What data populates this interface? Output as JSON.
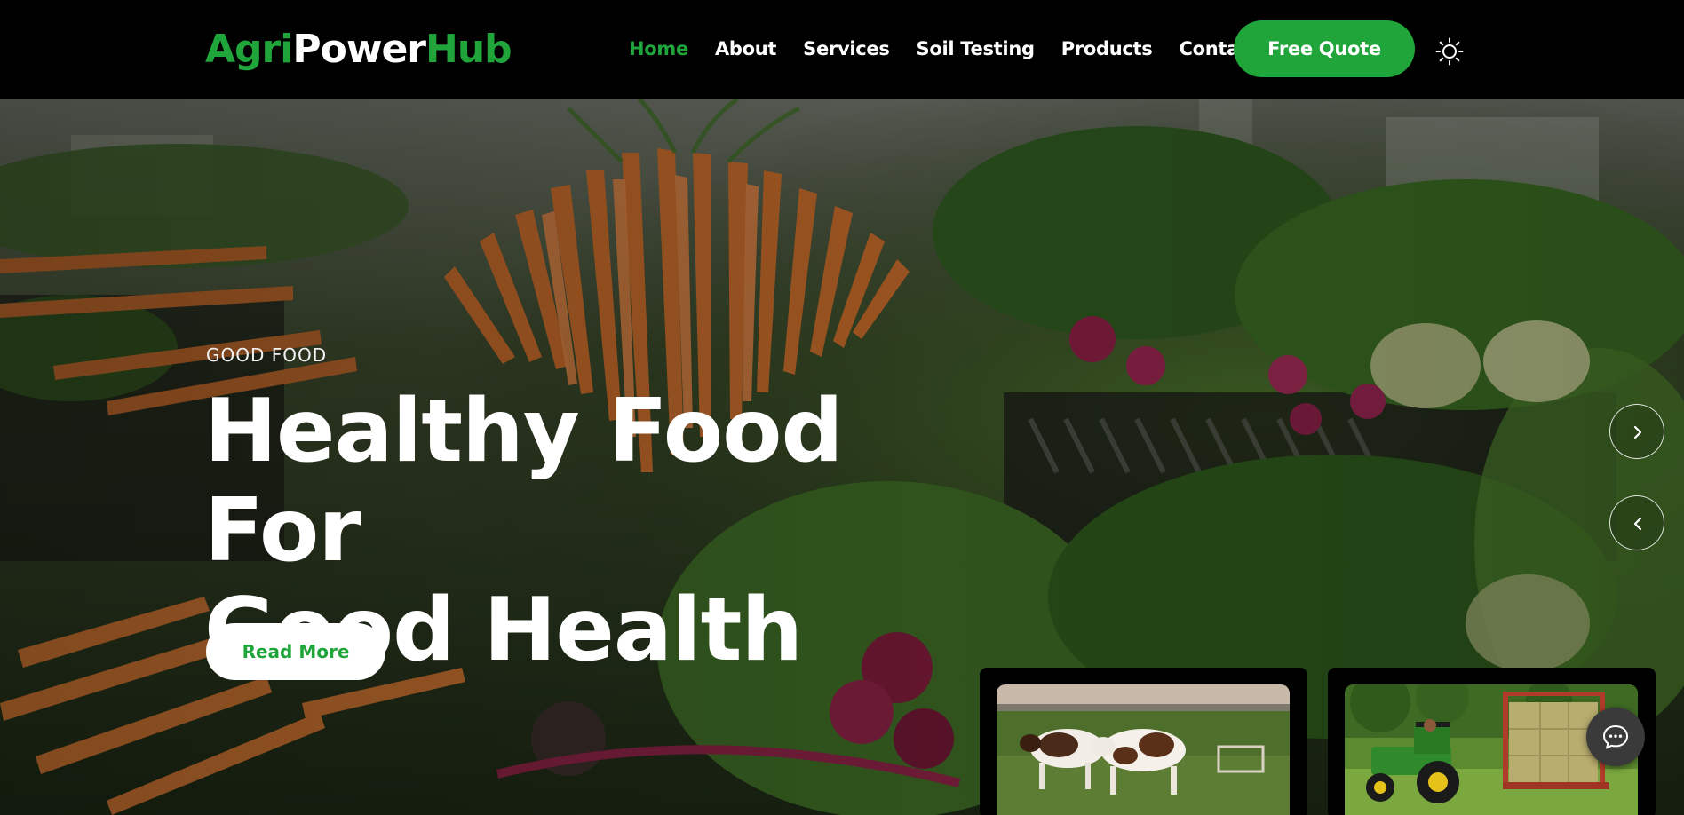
{
  "brand": {
    "part1": "Agri",
    "part2": "Power",
    "part3": "Hub"
  },
  "nav": [
    {
      "label": "Home",
      "active": true
    },
    {
      "label": "About",
      "active": false
    },
    {
      "label": "Services",
      "active": false
    },
    {
      "label": "Soil Testing",
      "active": false
    },
    {
      "label": "Products",
      "active": false
    },
    {
      "label": "Contact",
      "active": false
    }
  ],
  "header": {
    "cta_label": "Free Quote",
    "theme_icon": "sun-icon"
  },
  "hero": {
    "eyebrow": "GOOD FOOD",
    "headline_line1": "Healthy Food For",
    "headline_line2": "Good Health",
    "button_label": "Read More",
    "next_icon": "chevron-right-icon",
    "prev_icon": "chevron-left-icon"
  },
  "cards": [
    {
      "image": "cows-in-pasture"
    },
    {
      "image": "tractor-with-hay-bales"
    }
  ],
  "chat": {
    "icon": "chat-bubble-icon"
  },
  "colors": {
    "accent": "#1fa53a",
    "header_bg": "#000000",
    "text_light": "#ffffff"
  }
}
